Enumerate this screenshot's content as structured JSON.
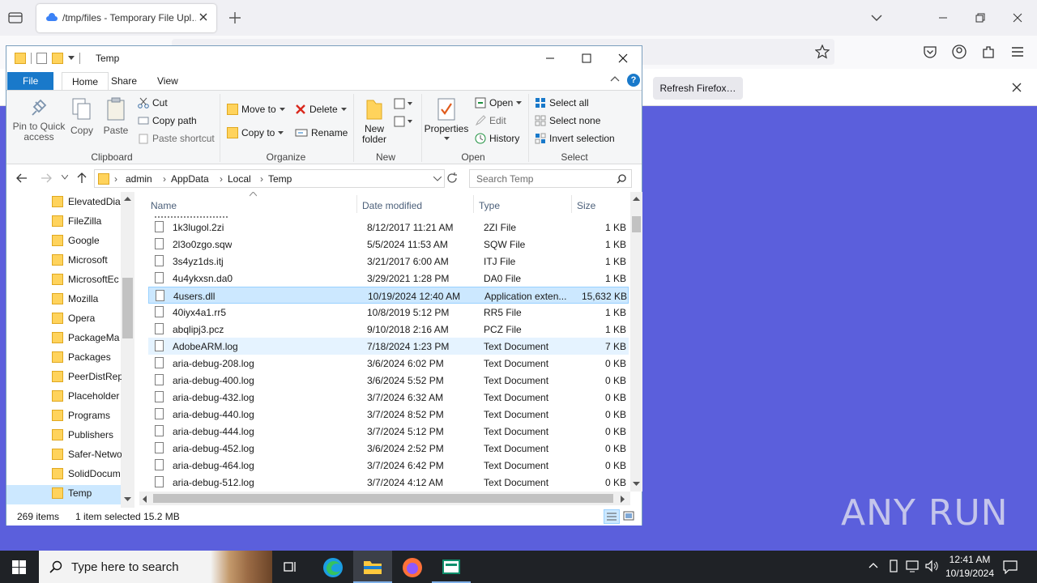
{
  "browser": {
    "tab_title": "/tmp/files - Temporary File Upl…",
    "refresh_label": "Refresh Firefox…"
  },
  "explorer": {
    "title": "Temp",
    "tabs": [
      "File",
      "Home",
      "Share",
      "View"
    ],
    "ribbon": {
      "clipboard": {
        "pin": "Pin to Quick access",
        "copy": "Copy",
        "paste": "Paste",
        "cut": "Cut",
        "copy_path": "Copy path",
        "paste_shortcut": "Paste shortcut",
        "group": "Clipboard"
      },
      "organize": {
        "move_to": "Move to",
        "copy_to": "Copy to",
        "delete": "Delete",
        "rename": "Rename",
        "group": "Organize"
      },
      "new": {
        "new_folder": "New folder",
        "group": "New"
      },
      "open": {
        "properties": "Properties",
        "open": "Open",
        "edit": "Edit",
        "history": "History",
        "group": "Open"
      },
      "select": {
        "select_all": "Select all",
        "select_none": "Select none",
        "invert": "Invert selection",
        "group": "Select"
      }
    },
    "breadcrumb": [
      "admin",
      "AppData",
      "Local",
      "Temp"
    ],
    "search_placeholder": "Search Temp",
    "nav_items": [
      "ElevatedDia",
      "FileZilla",
      "Google",
      "Microsoft",
      "MicrosoftEc",
      "Mozilla",
      "Opera",
      "PackageMa",
      "Packages",
      "PeerDistRep",
      "Placeholder",
      "Programs",
      "Publishers",
      "Safer-Netwo",
      "SolidDocum",
      "Temp"
    ],
    "columns": [
      "Name",
      "Date modified",
      "Type",
      "Size"
    ],
    "files": [
      {
        "name": "1k3lugol.2zi",
        "date": "8/12/2017 11:21 AM",
        "type": "2ZI File",
        "size": "1 KB"
      },
      {
        "name": "2l3o0zgo.sqw",
        "date": "5/5/2024 11:53 AM",
        "type": "SQW File",
        "size": "1 KB"
      },
      {
        "name": "3s4yz1ds.itj",
        "date": "3/21/2017 6:00 AM",
        "type": "ITJ File",
        "size": "1 KB"
      },
      {
        "name": "4u4ykxsn.da0",
        "date": "3/29/2021 1:28 PM",
        "type": "DA0 File",
        "size": "1 KB"
      },
      {
        "name": "4users.dll",
        "date": "10/19/2024 12:40 AM",
        "type": "Application exten...",
        "size": "15,632 KB"
      },
      {
        "name": "40iyx4a1.rr5",
        "date": "10/8/2019 5:12 PM",
        "type": "RR5 File",
        "size": "1 KB"
      },
      {
        "name": "abqlipj3.pcz",
        "date": "9/10/2018 2:16 AM",
        "type": "PCZ File",
        "size": "1 KB"
      },
      {
        "name": "AdobeARM.log",
        "date": "7/18/2024 1:23 PM",
        "type": "Text Document",
        "size": "7 KB"
      },
      {
        "name": "aria-debug-208.log",
        "date": "3/6/2024 6:02 PM",
        "type": "Text Document",
        "size": "0 KB"
      },
      {
        "name": "aria-debug-400.log",
        "date": "3/6/2024 5:52 PM",
        "type": "Text Document",
        "size": "0 KB"
      },
      {
        "name": "aria-debug-432.log",
        "date": "3/7/2024 6:32 AM",
        "type": "Text Document",
        "size": "0 KB"
      },
      {
        "name": "aria-debug-440.log",
        "date": "3/7/2024 8:52 PM",
        "type": "Text Document",
        "size": "0 KB"
      },
      {
        "name": "aria-debug-444.log",
        "date": "3/7/2024 5:12 PM",
        "type": "Text Document",
        "size": "0 KB"
      },
      {
        "name": "aria-debug-452.log",
        "date": "3/6/2024 2:52 PM",
        "type": "Text Document",
        "size": "0 KB"
      },
      {
        "name": "aria-debug-464.log",
        "date": "3/7/2024 6:42 PM",
        "type": "Text Document",
        "size": "0 KB"
      },
      {
        "name": "aria-debug-512.log",
        "date": "3/7/2024 4:12 AM",
        "type": "Text Document",
        "size": "0 KB"
      }
    ],
    "status": {
      "count": "269 items",
      "selected": "1 item selected  15.2 MB"
    }
  },
  "taskbar": {
    "search_placeholder": "Type here to search",
    "time": "12:41 AM",
    "date": "10/19/2024"
  },
  "watermark": "ANY RUN"
}
